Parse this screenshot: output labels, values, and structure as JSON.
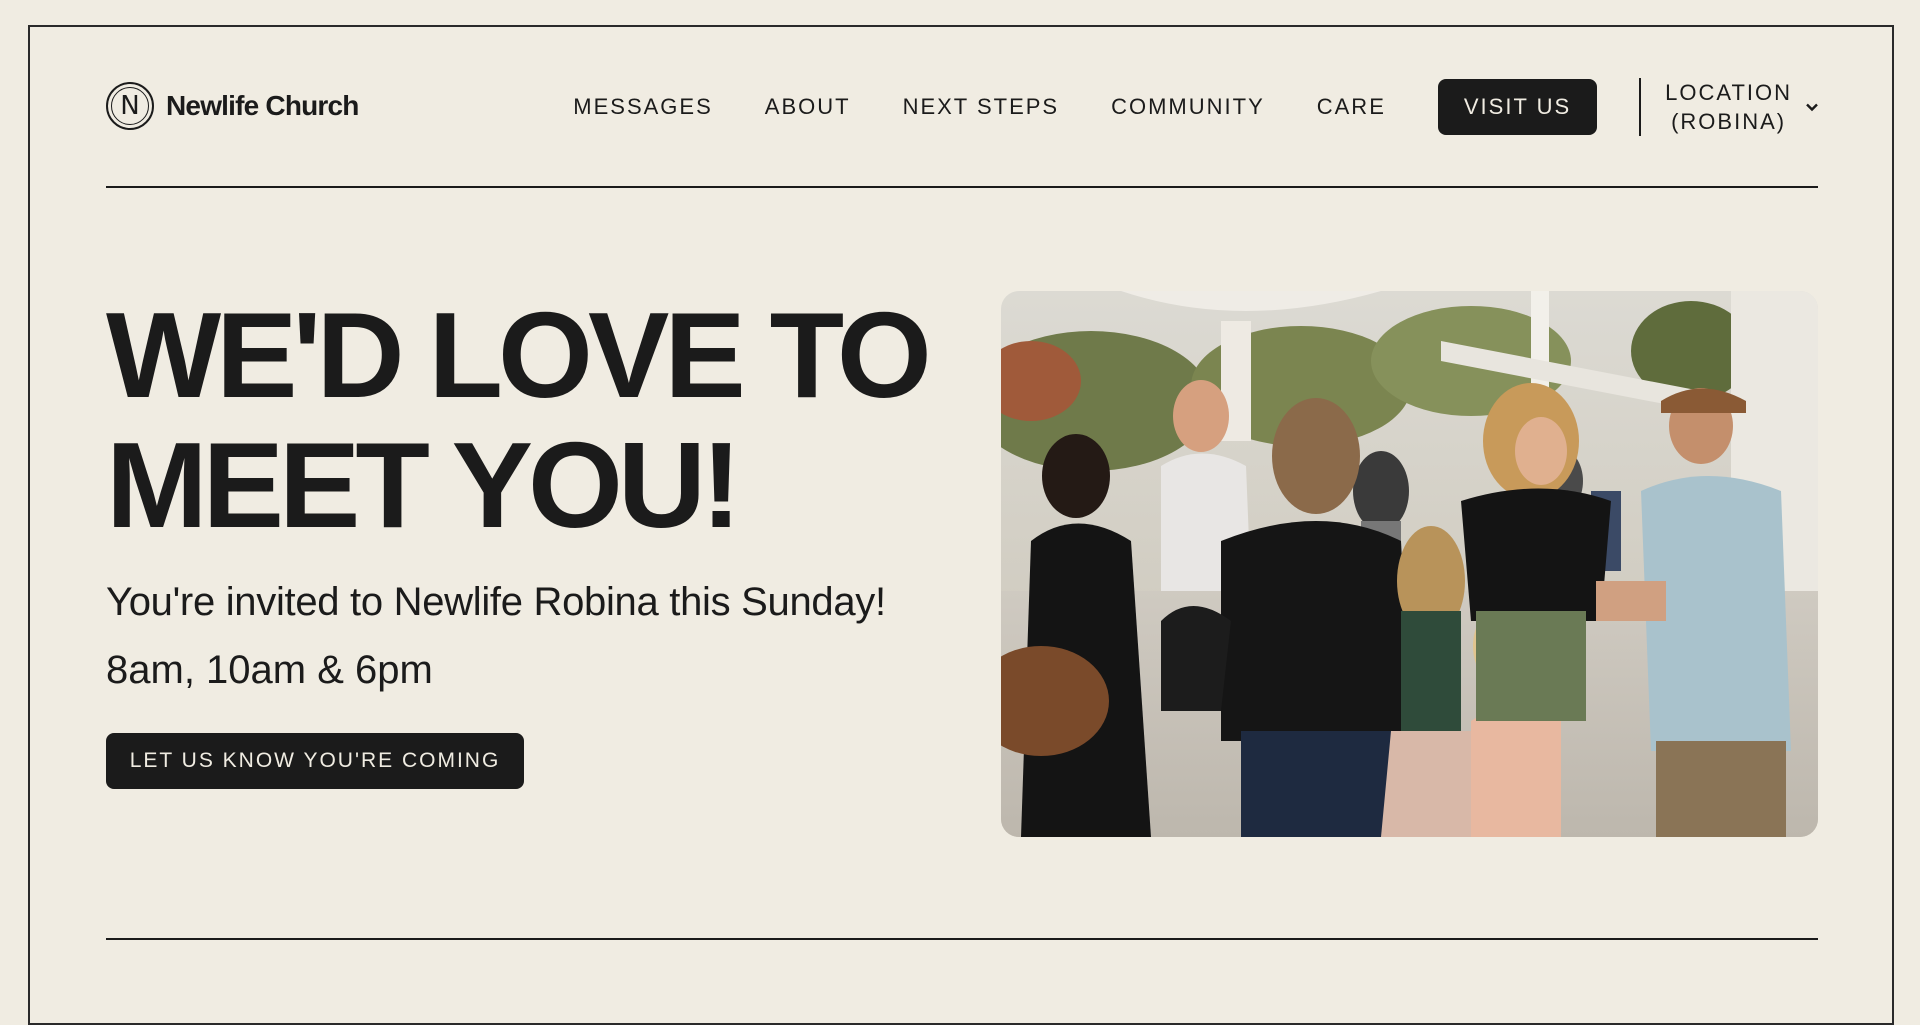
{
  "brand": {
    "logo_letter": "N",
    "name": "Newlife Church"
  },
  "nav": {
    "items": [
      {
        "label": "MESSAGES"
      },
      {
        "label": "ABOUT"
      },
      {
        "label": "NEXT STEPS"
      },
      {
        "label": "COMMUNITY"
      },
      {
        "label": "CARE"
      }
    ],
    "visit_label": "VISIT US",
    "location_line1": "LOCATION",
    "location_line2": "(ROBINA)"
  },
  "hero": {
    "title": "WE'D LOVE TO MEET YOU!",
    "subtitle": "You're invited to Newlife Robina this Sunday!",
    "times": "8am, 10am & 6pm",
    "cta_label": "LET US KNOW YOU'RE COMING"
  },
  "icons": {
    "location_dropdown": "chevron-down-icon"
  },
  "colors": {
    "background": "#f0ece2",
    "ink": "#1b1b1b"
  }
}
